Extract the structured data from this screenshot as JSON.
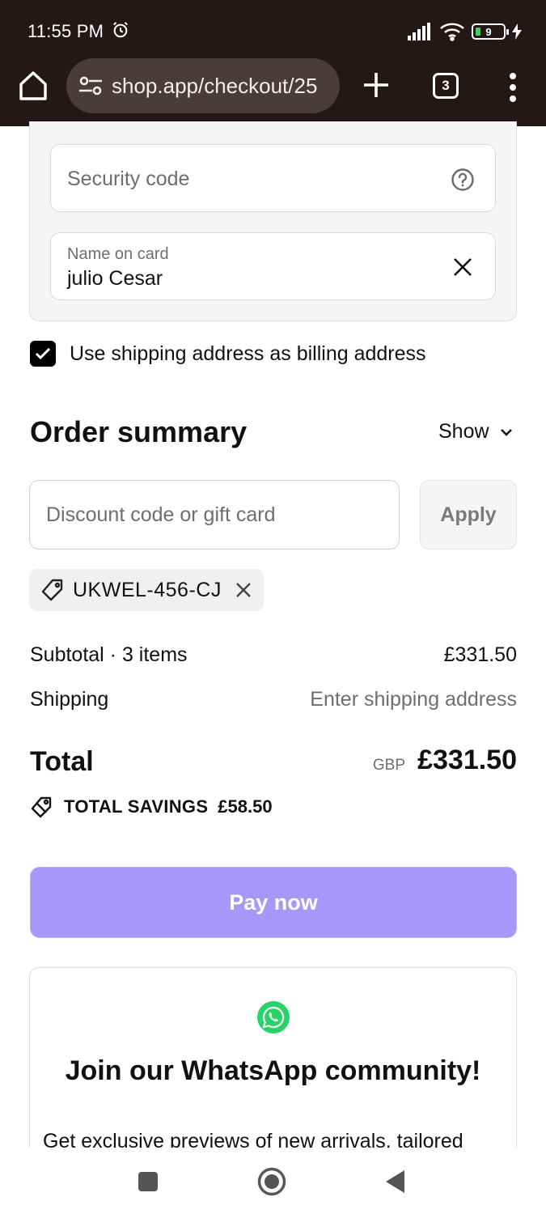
{
  "status_bar": {
    "time": "11:55 PM",
    "battery": "9"
  },
  "browser": {
    "url": "shop.app/checkout/25",
    "tab_count": "3"
  },
  "payment": {
    "security_code_placeholder": "Security code",
    "name_label": "Name on card",
    "name_value": "julio Cesar"
  },
  "billing": {
    "checkbox_label": "Use shipping address as billing address",
    "checked": true
  },
  "order_summary": {
    "title": "Order summary",
    "toggle_label": "Show",
    "discount_placeholder": "Discount code or gift card",
    "apply_label": "Apply",
    "applied_code": "UKWEL-456-CJ",
    "subtotal_label": "Subtotal · 3 items",
    "subtotal_value": "£331.50",
    "shipping_label": "Shipping",
    "shipping_value": "Enter shipping address",
    "total_label": "Total",
    "currency": "GBP",
    "total_value": "£331.50",
    "savings_label": "TOTAL SAVINGS",
    "savings_value": "£58.50"
  },
  "pay_button": {
    "label": "Pay now",
    "color": "#a996f9"
  },
  "whatsapp_card": {
    "title": "Join our WhatsApp community!",
    "body": "Get exclusive previews of new arrivals, tailored",
    "icon_color": "#25d366"
  }
}
